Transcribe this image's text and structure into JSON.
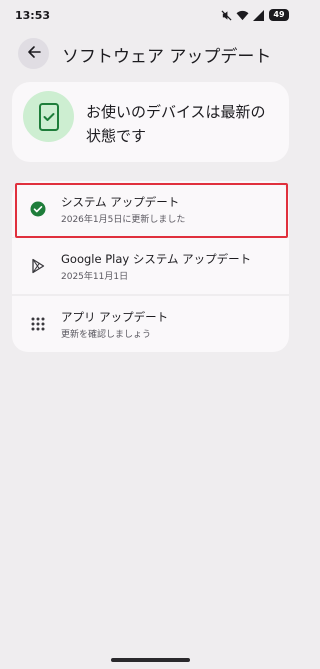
{
  "status_bar": {
    "time": "13:53",
    "battery": "49"
  },
  "header": {
    "title": "ソフトウェア アップデート"
  },
  "status_card": {
    "message": "お使いのデバイスは最新の状態です"
  },
  "updates": [
    {
      "title": "システム アップデート",
      "subtitle": "2026年1月5日に更新しました",
      "icon": "check-circle-icon"
    },
    {
      "title": "Google Play システム アップデート",
      "subtitle": "2025年11月1日",
      "icon": "google-play-icon"
    },
    {
      "title": "アプリ アップデート",
      "subtitle": "更新を確認しましょう",
      "icon": "apps-grid-icon"
    }
  ],
  "colors": {
    "background": "#efedef",
    "card": "#faf8fa",
    "accent_green": "#1e7d3a",
    "status_circle": "#cdeed1",
    "highlight": "#e0303d"
  }
}
